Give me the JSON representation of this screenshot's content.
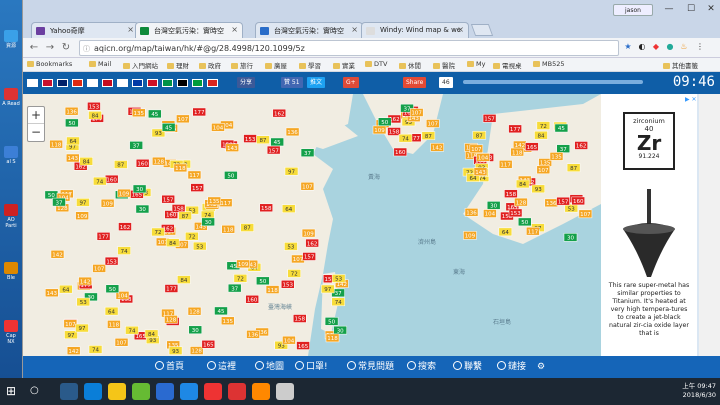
{
  "desktop": {
    "icons": [
      {
        "label": "資源",
        "color": "#3aa0e8"
      },
      {
        "label": "A Read",
        "color": "#d33"
      },
      {
        "label": "al S",
        "color": "#3c7fd6"
      },
      {
        "label": "AO Parti",
        "color": "#c22"
      },
      {
        "label": "Ble",
        "color": "#d80"
      },
      {
        "label": "Cap NX",
        "color": "#e33"
      }
    ]
  },
  "browser": {
    "tabs": [
      {
        "label": "Yahoo奇摩",
        "color": "#6b3fa0",
        "active": false
      },
      {
        "label": "台灣空氣污染：實時空",
        "color": "#0f8a3a",
        "active": true
      },
      {
        "label": "台灣空氣污染：實時空",
        "color": "#2a6dc9",
        "active": false
      },
      {
        "label": "Windy: Wind map & we",
        "color": "#ddd",
        "active": false
      }
    ],
    "profile": "jason",
    "url": "aqicn.org/map/taiwan/hk/#@g/28.4998/120.1099/5z",
    "bookmarks": [
      "Bookmarks",
      "Mail",
      "入門網站",
      "理財",
      "政府",
      "旅行",
      "廣屋",
      "學習",
      "實業",
      "DTV",
      "休閒",
      "醫院",
      "My",
      "電視桌",
      "MB525",
      "其他書籤"
    ]
  },
  "site": {
    "share_buttons": [
      {
        "label": "分享",
        "color": "#3b5998"
      },
      {
        "label": "贊 51",
        "color": "#4267b2"
      },
      {
        "label": "推文",
        "color": "#1da1f2"
      },
      {
        "label": "G+",
        "color": "#dd4b39"
      },
      {
        "label": "Share",
        "color": "#e34a35"
      },
      {
        "label": "46",
        "color": "#ffffff"
      }
    ],
    "clock": "09:46",
    "zoom_in": "+",
    "zoom_out": "−"
  },
  "map": {
    "labels": [
      "黃海",
      "東海",
      "臺灣海峽",
      "濟州島",
      "石垣島"
    ],
    "aqi_points": [
      {
        "v": 107,
        "c": "#f5a623"
      },
      {
        "v": 162,
        "c": "#e02020"
      },
      {
        "v": 117,
        "c": "#f5a623"
      },
      {
        "v": 160,
        "c": "#e02020"
      },
      {
        "v": 87,
        "c": "#f7dc3a"
      },
      {
        "v": 153,
        "c": "#e02020"
      },
      {
        "v": 104,
        "c": "#f5a623"
      },
      {
        "v": 93,
        "c": "#f7dc3a"
      },
      {
        "v": 158,
        "c": "#e02020"
      },
      {
        "v": 143,
        "c": "#f5a623"
      },
      {
        "v": 177,
        "c": "#e02020"
      },
      {
        "v": 165,
        "c": "#e02020"
      },
      {
        "v": 109,
        "c": "#f5a623"
      },
      {
        "v": 37,
        "c": "#14a04a"
      },
      {
        "v": 107,
        "c": "#f5a623"
      },
      {
        "v": 50,
        "c": "#14a04a"
      },
      {
        "v": 74,
        "c": "#f7dc3a"
      },
      {
        "v": 142,
        "c": "#f5a623"
      },
      {
        "v": 157,
        "c": "#e02020"
      },
      {
        "v": 30,
        "c": "#14a04a"
      },
      {
        "v": 53,
        "c": "#f7dc3a"
      },
      {
        "v": 97,
        "c": "#f7dc3a"
      },
      {
        "v": 118,
        "c": "#f5a623"
      },
      {
        "v": 72,
        "c": "#f7dc3a"
      },
      {
        "v": 135,
        "c": "#f5a623"
      },
      {
        "v": 64,
        "c": "#f7dc3a"
      },
      {
        "v": 84,
        "c": "#f7dc3a"
      },
      {
        "v": 136,
        "c": "#f5a623"
      },
      {
        "v": 128,
        "c": "#f5a623"
      },
      {
        "v": 45,
        "c": "#14a04a"
      }
    ]
  },
  "ad": {
    "element_name": "zirconium",
    "number": "40",
    "symbol": "Zr",
    "mass": "91.224",
    "text": "This rare super-metal has similar properties to Titanium. It's heated at very high tempera-tures to create a jet-black natural zir-cia oxide layer that is",
    "adchoices": "▶ ✕"
  },
  "menu": [
    {
      "label": "首頁"
    },
    {
      "label": "這裡"
    },
    {
      "label": "地圖"
    },
    {
      "label": "口罩!"
    },
    {
      "label": "常見問題"
    },
    {
      "label": "搜索"
    },
    {
      "label": "聯繫"
    },
    {
      "label": "鏈接"
    },
    {
      "label": "⚙"
    }
  ],
  "taskbar": {
    "time": "上午 09:47",
    "date": "2018/6/30"
  }
}
